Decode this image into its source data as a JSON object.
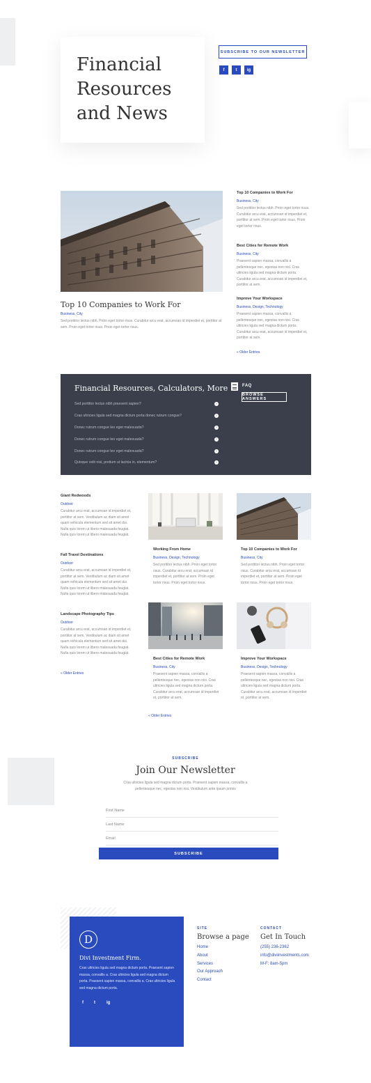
{
  "hero": {
    "title_lines": [
      "Financial",
      "Resources",
      "and News"
    ],
    "subscribe_btn": "SUBSCRIBE TO OUR NEWSLETTER",
    "social": [
      "f",
      "t",
      "ig"
    ]
  },
  "featured": {
    "title": "Top 10 Companies to Work For",
    "meta": "Business, City",
    "excerpt": "Sed porttitor lectus nibh. Proin eget tortor risus. Curabitur arcu erat, accumsan id imperdiet et, porttitor at sem. Proin eget tortor risus. Proin eget tortor risus."
  },
  "side_posts": [
    {
      "title": "Top 10 Companies to Work For",
      "meta": "Business, City",
      "excerpt": "Sed porttitor lectus nibh. Proin eget tortor risus. Curabitur arcu erat, accumsan id imperdiet et, porttitor at sem. Proin eget tortor risus. Proin eget tortor risus."
    },
    {
      "title": "Best Cities for Remote Work",
      "meta": "Business, City",
      "excerpt": "Praesent sapien massa, convallis a pellentesque nec, egestas non nisi. Cras ultricies ligula sed magna dictum porta. Curabitur arcu erat, accumsan id imperdiet et, porttitor at sem."
    },
    {
      "title": "Improve Your Workspace",
      "meta": "Business, Design, Technology",
      "excerpt": "Praesent sapien massa, convallis a pellentesque nec, egestas non nisi. Cras ultricies ligula sed magna dictum porta. Curabitur arcu erat, accumsan id imperdiet et, porttitor at sem."
    }
  ],
  "older_entries": "« Older Entries",
  "faq": {
    "title": "Financial Resources, Calculators, More",
    "questions": [
      "Sed porttitor lectus nibh praesent sapien?",
      "Cras ultricies ligula sed magna dictum porta donec rutrum congue?",
      "Donec rutrum congue leo eget malesuada?",
      "Donec rutrum congue leo eget malesuada?",
      "Donec rutrum congue leo eget malesuada?",
      "Quisque velit nisi, pretium ut lacinia in, elementum?"
    ],
    "faq_label": "FAQ",
    "browse_btn": "BROWSE ANSWERS"
  },
  "list_posts": [
    {
      "title": "Giant Redwoods",
      "meta": "Outdoor",
      "excerpt": "Curabitur arcu erat, accumsan id imperdiet et, porttitor at sem. Vestibulum ac diam sit amet quam vehicula elementum sed sit amet dui. Nulla quis lorem ut libero malesuada feugiat. Nulla quis lorem ut libero malesuada feugiat."
    },
    {
      "title": "Fall Travel Destinations",
      "meta": "Outdoor",
      "excerpt": "Curabitur arcu erat, accumsan id imperdiet et, porttitor at sem. Vestibulum ac diam sit amet quam vehicula elementum sed sit amet dui. Nulla quis lorem ut libero malesuada feugiat. Nulla quis lorem ut libero malesuada feugiat."
    },
    {
      "title": "Landscape Photography Tips",
      "meta": "Outdoor",
      "excerpt": "Curabitur arcu erat, accumsan id imperdiet et, porttitor at sem. Vestibulum ac diam sit amet quam vehicula elementum sed sit amet dui. Nulla quis lorem ut libero malesuada feugiat. Nulla quis lorem ut libero malesuada feugiat."
    }
  ],
  "grid_posts": [
    {
      "title": "Working From Home",
      "meta": "Business, Design, Technology",
      "excerpt": "Sed porttitor lectus nibh. Proin eget tortor risus. Curabitur arcu erat, accumsan id imperdiet et, porttitor at sem. Proin eget tortor risus. Proin eget tortor risus."
    },
    {
      "title": "Top 10 Companies to Work For",
      "meta": "Business, City",
      "excerpt": "Sed porttitor lectus nibh. Proin eget tortor risus. Curabitur arcu erat, accumsan id imperdiet et, porttitor at sem. Proin eget tortor risus. Proin eget tortor risus."
    },
    {
      "title": "Best Cities for Remote Work",
      "meta": "Business, City",
      "excerpt": "Praesent sapien massa, convallis a pellentesque nec, egestas non nisi. Cras ultricies ligula sed magna dictum porta. Curabitur arcu erat, accumsan id imperdiet et, porttitor at sem."
    },
    {
      "title": "Improve Your Workspace",
      "meta": "Business, Design, Technology",
      "excerpt": "Praesent sapien massa, convallis a pellentesque nec, egestas non nisi. Cras ultricies ligula sed magna dictum porta. Curabitur arcu erat, accumsan id imperdiet et, porttitor at sem."
    }
  ],
  "newsletter": {
    "label": "SUBSCRIBE",
    "title": "Join Our Newsletter",
    "text": "Cras ultricies ligula sed magna dictum porta. Praesent sapien massa, convallis a pellentesque nec, egestas non nisi. Vestibulum ante ipsum primis",
    "first_name": "First Name",
    "last_name": "Last Name",
    "email": "Email",
    "button": "SUBSCRIBE"
  },
  "footer": {
    "logo_letter": "D",
    "company": "Divi Investment Firm.",
    "about": "Cras ultricies ligula sed magna dictum porta. Praesent sapien massa, convallis a. Cras ultricies ligula sed magna dictum porta. Praesent sapien massa, convallis a. Cras ultricies ligula sed magna dictum porta.",
    "social": [
      "f",
      "t",
      "ig"
    ],
    "site_label": "SITE",
    "site_title": "Browse a page",
    "links": [
      "Home",
      "About",
      "Services",
      "Our Approach",
      "Contact"
    ],
    "contact_label": "CONTACT",
    "contact_title": "Get In Touch",
    "phone": "(255) 236-2362",
    "email": "info@diviinvestments.com",
    "hours": "M-F: 8am-5pm"
  },
  "colors": {
    "accent": "#2a4bbd",
    "dark_panel": "#3b3f4c"
  }
}
